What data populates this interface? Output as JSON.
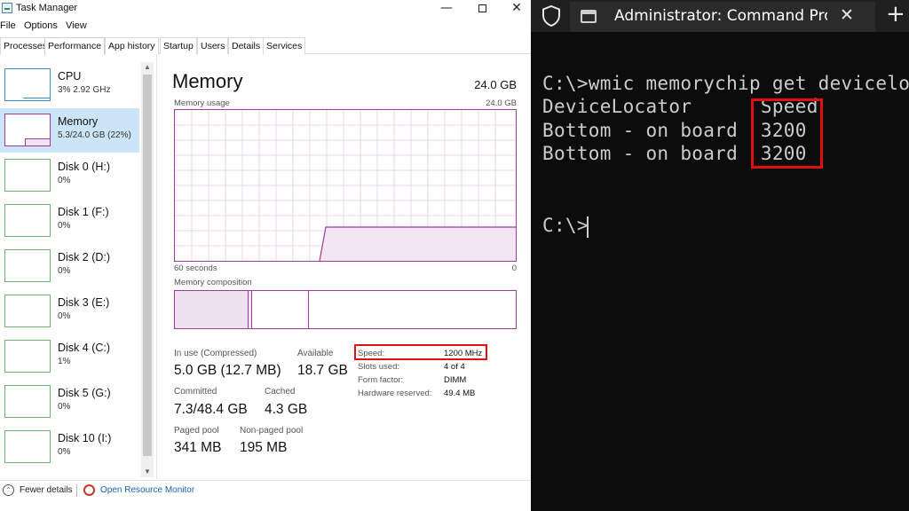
{
  "taskmanager": {
    "title": "Task Manager",
    "window": {
      "minimize": "—",
      "close": "✕"
    },
    "menu": [
      "File",
      "Options",
      "View"
    ],
    "tabs": [
      "Processes",
      "Performance",
      "App history",
      "Startup",
      "Users",
      "Details",
      "Services"
    ],
    "active_tab": "Performance",
    "sidebar": [
      {
        "name": "CPU",
        "sub": "3% 2.92 GHz"
      },
      {
        "name": "Memory",
        "sub": "5.3/24.0 GB (22%)"
      },
      {
        "name": "Disk 0 (H:)",
        "sub": "0%"
      },
      {
        "name": "Disk 1 (F:)",
        "sub": "0%"
      },
      {
        "name": "Disk 2 (D:)",
        "sub": "0%"
      },
      {
        "name": "Disk 3 (E:)",
        "sub": "0%"
      },
      {
        "name": "Disk 4 (C:)",
        "sub": "1%"
      },
      {
        "name": "Disk 5 (G:)",
        "sub": "0%"
      },
      {
        "name": "Disk 10 (I:)",
        "sub": "0%"
      }
    ],
    "memory": {
      "title": "Memory",
      "total": "24.0 GB",
      "usage_label": "Memory usage",
      "usage_max": "24.0 GB",
      "axis_left": "60 seconds",
      "axis_right": "0",
      "composition_label": "Memory composition",
      "in_use_label": "In use (Compressed)",
      "in_use_value": "5.0 GB (12.7 MB)",
      "available_label": "Available",
      "available_value": "18.7 GB",
      "committed_label": "Committed",
      "committed_value": "7.3/48.4 GB",
      "cached_label": "Cached",
      "cached_value": "4.3 GB",
      "paged_label": "Paged pool",
      "paged_value": "341 MB",
      "nonpaged_label": "Non-paged pool",
      "nonpaged_value": "195 MB",
      "speed_label": "Speed:",
      "speed_value": "1200 MHz",
      "slots_label": "Slots used:",
      "slots_value": "4 of 4",
      "form_label": "Form factor:",
      "form_value": "DIMM",
      "hwres_label": "Hardware reserved:",
      "hwres_value": "49.4 MB"
    },
    "footer": {
      "fewer_details": "Fewer details",
      "resource_monitor": "Open Resource Monitor"
    }
  },
  "terminal": {
    "tab_title": "Administrator: Command Prom",
    "close": "✕",
    "new_tab": "+",
    "lines": [
      "C:\\>wmic memorychip get devicelocator, speed",
      "DeviceLocator      Speed",
      "Bottom - on board  3200",
      "Bottom - on board  3200",
      "",
      "C:\\>"
    ]
  },
  "colors": {
    "memory_accent": "#9b3c9b",
    "selection": "#cce4f7",
    "highlight_red": "#e01010",
    "terminal_bg": "#0c0c0c",
    "link_blue": "#1a5fb4"
  }
}
